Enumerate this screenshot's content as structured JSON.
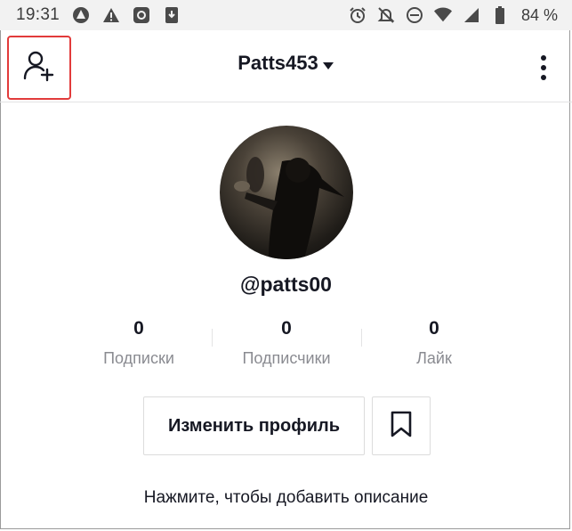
{
  "status_bar": {
    "time": "19:31",
    "left_icons": [
      "app-notification-icon",
      "warning-icon",
      "camera-app-icon",
      "download-icon"
    ],
    "right_icons": [
      "alarm-icon",
      "mute-icon",
      "do-not-disturb-icon",
      "wifi-icon",
      "signal-icon",
      "battery-icon"
    ],
    "battery": "84 %"
  },
  "header": {
    "username": "Patts453",
    "add_friend_icon": "add-user-icon",
    "menu_icon": "more-vertical-icon",
    "highlight_color": "#e23b3b"
  },
  "profile": {
    "handle": "@patts00",
    "stats": [
      {
        "value": "0",
        "label": "Подписки"
      },
      {
        "value": "0",
        "label": "Подписчики"
      },
      {
        "value": "0",
        "label": "Лайк"
      }
    ],
    "edit_button": "Изменить профиль",
    "bookmark_icon": "bookmark-icon",
    "bio_prompt": "Нажмите, чтобы добавить описание"
  }
}
